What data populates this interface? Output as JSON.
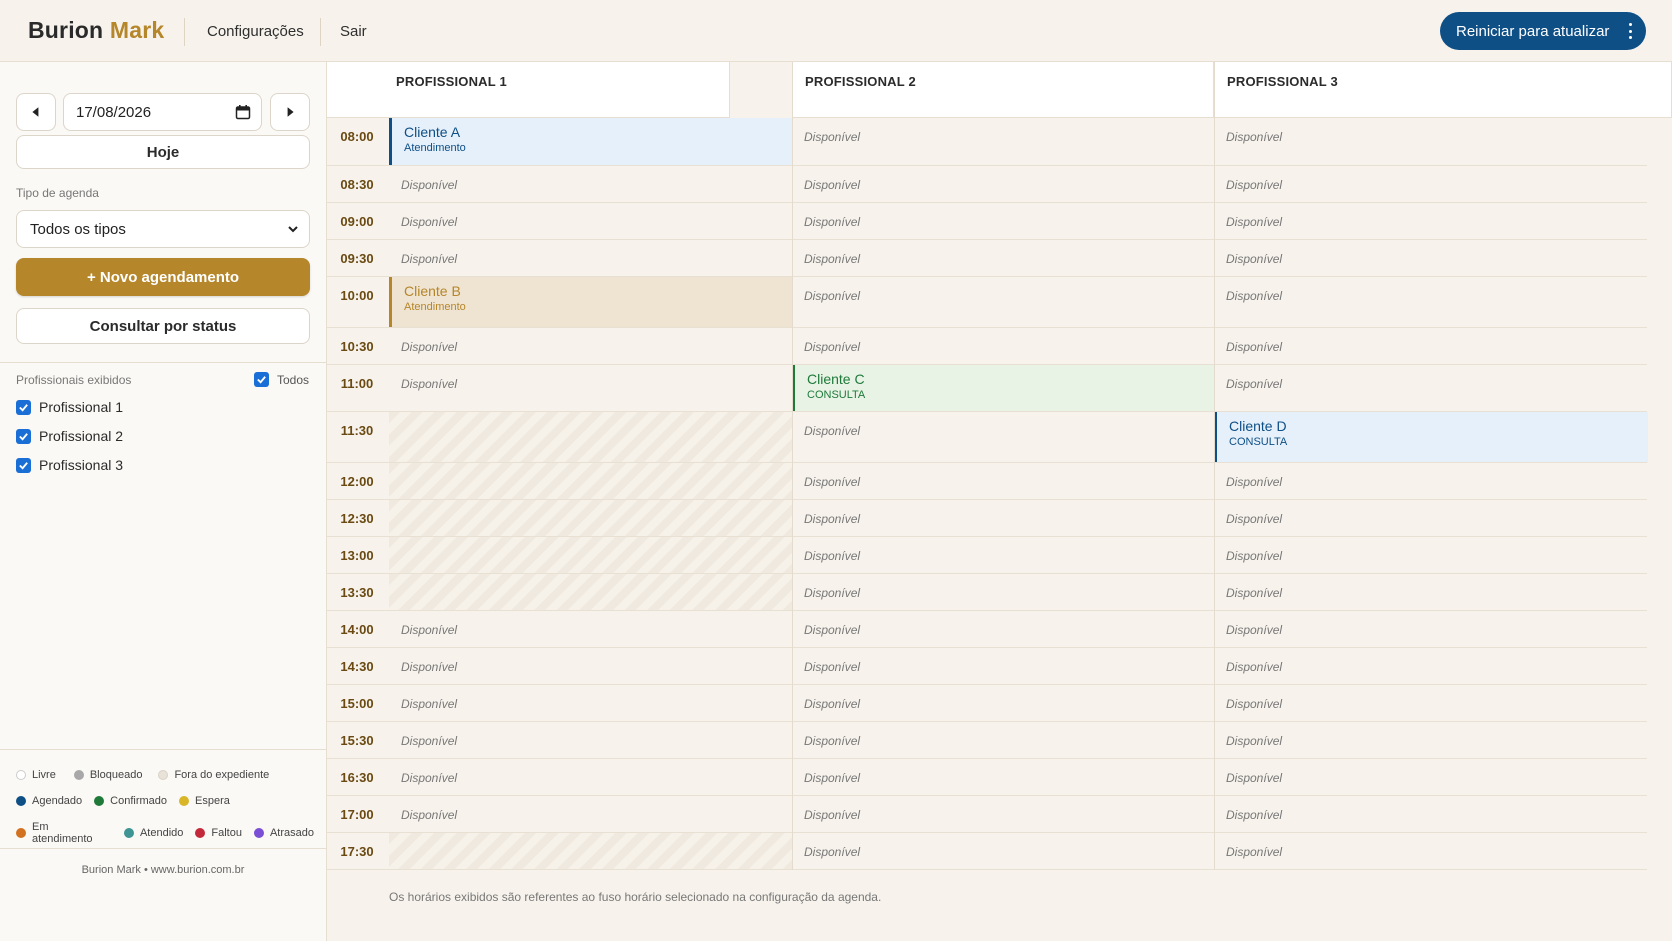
{
  "header": {
    "brand_main": "Burion",
    "brand_accent": "Mark",
    "nav_settings": "Configurações",
    "nav_logout": "Sair",
    "update_button": "Reiniciar para atualizar"
  },
  "sidebar": {
    "date_value": "17/08/2026",
    "today_button": "Hoje",
    "agenda_type_label": "Tipo de agenda",
    "agenda_type_selected": "Todos os tipos",
    "new_appointment_button": "+ Novo agendamento",
    "status_button": "Consultar por status",
    "professionals_label": "Profissionais exibidos",
    "all_label": "Todos",
    "professionals": [
      "Profissional 1",
      "Profissional 2",
      "Profissional 3"
    ],
    "legend": [
      {
        "label": "Livre",
        "color": "#ffffff"
      },
      {
        "label": "Bloqueado",
        "color": "#a8a8a8"
      },
      {
        "label": "Fora do expediente",
        "color": "#e8e2d8"
      },
      {
        "label": "Agendado",
        "color": "#0e4f86"
      },
      {
        "label": "Confirmado",
        "color": "#1f7a3a"
      },
      {
        "label": "Espera",
        "color": "#d8b628"
      },
      {
        "label": "Em atendimento",
        "color": "#d2711f"
      },
      {
        "label": "Atendido",
        "color": "#3f9494"
      },
      {
        "label": "Faltou",
        "color": "#c3283b"
      },
      {
        "label": "Atrasado",
        "color": "#7a4fd6"
      }
    ],
    "footer": "Burion Mark • www.burion.com.br"
  },
  "grid": {
    "columns": [
      "PROFISSIONAL 1",
      "PROFISSIONAL 2",
      "PROFISSIONAL 3"
    ],
    "times": [
      "08:00",
      "08:30",
      "09:00",
      "09:30",
      "10:00",
      "10:30",
      "11:00",
      "11:30",
      "12:00",
      "12:30",
      "13:00",
      "13:30",
      "14:00",
      "14:30",
      "15:00",
      "15:30",
      "16:30",
      "17:00",
      "17:30"
    ],
    "available_label": "Disponível",
    "appointments": [
      {
        "client": "Cliente A",
        "type": "Atendimento",
        "color": "#0e4f86"
      },
      {
        "client": "Cliente B",
        "type": "Atendimento",
        "color": "#b5862a"
      },
      {
        "client": "Cliente C",
        "type": "CONSULTA",
        "color": "#1f7a3a"
      },
      {
        "client": "Cliente D",
        "type": "CONSULTA",
        "color": "#0e4f86"
      }
    ],
    "timezone_note": "Os horários exibidos são referentes ao fuso horário selecionado na configuração da agenda."
  }
}
